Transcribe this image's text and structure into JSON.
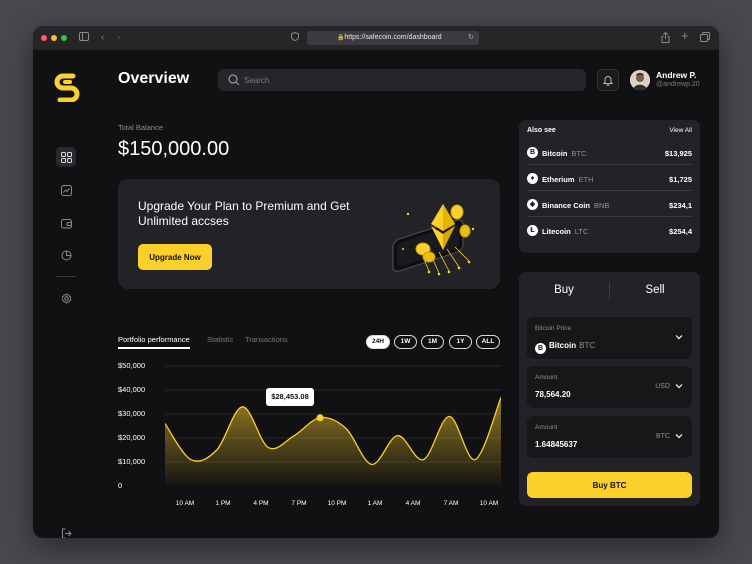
{
  "browser": {
    "url": "https://safecoin.com/dashboard"
  },
  "header": {
    "title": "Overview",
    "search_placeholder": "Search",
    "user_name": "Andrew P.",
    "user_handle": "@andrewp.20"
  },
  "balance": {
    "label": "Total Balance",
    "value": "$150,000.00"
  },
  "promo": {
    "text": "Upgrade Your Plan to Premium and Get Unlimited accses",
    "button": "Upgrade Now"
  },
  "performance": {
    "tabs": [
      "Portfolio performance",
      "Statistic",
      "Transactions"
    ],
    "ranges": [
      "24H",
      "1W",
      "1M",
      "1Y",
      "ALL"
    ],
    "active_range": "24H",
    "tooltip": "$28,453.08"
  },
  "chart_data": {
    "type": "area",
    "y_ticks": [
      "$50,000",
      "$40,000",
      "$30,000",
      "$20,000",
      "$10,000",
      "0"
    ],
    "x_ticks": [
      "10 AM",
      "1 PM",
      "4 PM",
      "7 PM",
      "10 PM",
      "1 AM",
      "4 AM",
      "7 AM",
      "10 AM"
    ],
    "ylim": [
      0,
      50000
    ],
    "series": [
      {
        "values": [
          26000,
          11000,
          15000,
          33000,
          16000,
          21000,
          28453,
          24000,
          9000,
          21000,
          11000,
          29000,
          11000,
          37000
        ]
      }
    ],
    "highlight_value": 28453.08,
    "accent_color": "#fcd02a"
  },
  "also_see": {
    "title": "Also see",
    "view_all": "View All",
    "coins": [
      {
        "name": "Bitcoin",
        "symbol": "BTC",
        "value": "$13,925",
        "icon": "bitcoin-icon"
      },
      {
        "name": "Etherium",
        "symbol": "ETH",
        "value": "$1,725",
        "icon": "ethereum-icon"
      },
      {
        "name": "Binance Coin",
        "symbol": "BNB",
        "value": "$234,1",
        "icon": "binance-icon"
      },
      {
        "name": "Litecoin",
        "symbol": "LTC",
        "value": "$254,4",
        "icon": "litecoin-icon"
      }
    ]
  },
  "trade": {
    "buy_tab": "Buy",
    "sell_tab": "Sell",
    "price_label": "Bitcoin Price",
    "price_coin": "Bitcoin",
    "price_symbol": "BTC",
    "amount_label": "Amount",
    "amount_value": "78,564.20",
    "amount_unit": "USD",
    "amount2_label": "Amount",
    "amount2_value": "1.64845637",
    "amount2_unit": "BTC",
    "button": "Buy BTC"
  },
  "colors": {
    "accent": "#fcd02a",
    "background": "#111113",
    "card": "#232327"
  }
}
